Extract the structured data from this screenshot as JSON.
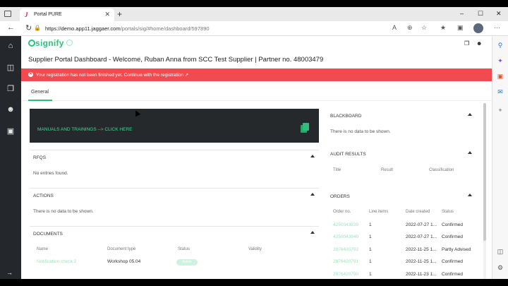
{
  "browser": {
    "tab_title": "Portal PURE",
    "tab_favicon": "J",
    "tab_close": "✕",
    "new_tab": "+",
    "url_scheme_host": "https://demo.app11.jaggaer.com",
    "url_path": "/portals/sig/#home/dashboard/597890",
    "window_controls": {
      "minimize": "–",
      "maximize": "☐",
      "close": "✕"
    }
  },
  "nav_icons": [
    "home-icon",
    "database-icon",
    "documents-icon",
    "user-hand-icon",
    "truck-icon",
    "expand-arrow-icon"
  ],
  "app": {
    "logo_text": "signify",
    "page_title": "Supplier Portal Dashboard - Welcome, Ruban Anna from SCC Test Supplier | Partner no. 48003479",
    "alert_text": "Your registration has not been finished yet. Continue with the registration",
    "alert_icon": "✕",
    "subtab_general": "General"
  },
  "banner": {
    "label": "MANUALS AND TRAININGS --> CLICK HERE"
  },
  "rfqs": {
    "title": "RFQS",
    "empty": "No entries found."
  },
  "actions": {
    "title": "ACTIONS",
    "empty": "There is no data to be shown."
  },
  "documents": {
    "title": "DOCUMENTS",
    "columns": [
      "Name",
      "Document type",
      "Status",
      "Validity"
    ],
    "rows": [
      {
        "name": "Notification check 2",
        "type": "Workshop 05.04",
        "status": "Active",
        "validity": ""
      }
    ]
  },
  "blackboard": {
    "title": "BLACKBOARD",
    "empty": "There is no data to be shown."
  },
  "audit": {
    "title": "AUDIT RESULTS",
    "columns": [
      "Title",
      "Result",
      "Classification"
    ]
  },
  "orders": {
    "title": "ORDERS",
    "columns": [
      "Order no.",
      "Line items",
      "Date created",
      "Status"
    ],
    "rows": [
      {
        "order": "4250043839",
        "lines": "1",
        "date": "2022-07-27 1...",
        "status": "Confirmed"
      },
      {
        "order": "4250043840",
        "lines": "1",
        "date": "2022-07-27 1...",
        "status": "Confirmed"
      },
      {
        "order": "2976420792",
        "lines": "1",
        "date": "2022-11-25 1...",
        "status": "Partly Advised"
      },
      {
        "order": "2976420791",
        "lines": "1",
        "date": "2022-11-25 1...",
        "status": "Confirmed"
      },
      {
        "order": "2976420790",
        "lines": "1",
        "date": "2022-11-23 1...",
        "status": "Confirmed"
      }
    ]
  },
  "colors": {
    "brand": "#2fbf7b",
    "alert": "#ef4b50",
    "banner": "#25292c",
    "nav": "#24282c"
  }
}
